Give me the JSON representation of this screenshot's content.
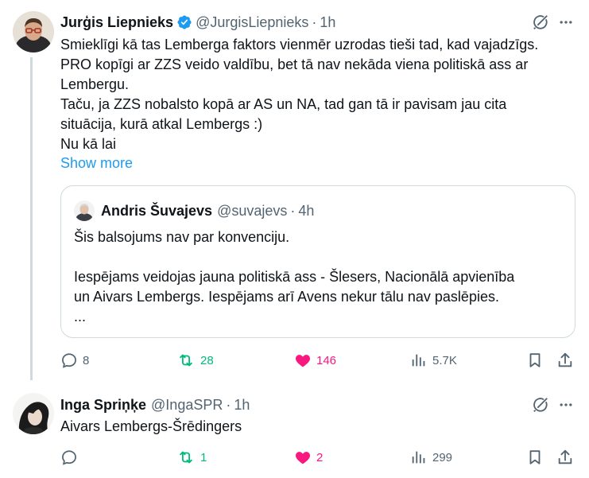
{
  "tweets": [
    {
      "name": "Jurģis Liepnieks",
      "handle": "@JurgisLiepnieks",
      "separator": "·",
      "time": "1h",
      "verified": true,
      "lines": [
        "Smieklīgi kā tas Lemberga faktors vienmēr uzrodas tieši tad, kad vajadzīgs.",
        "PRO kopīgi ar ZZS veido valdību, bet tā nav nekāda viena politiskā ass ar",
        "Lembergu.",
        "Taču, ja ZZS nobalsto kopā ar AS un NA, tad gan tā ir pavisam jau cita",
        "situācija, kurā atkal Lembergs :)",
        "Nu kā lai"
      ],
      "show_more": "Show more",
      "quote": {
        "name": "Andris Šuvajevs",
        "handle": "@suvajevs",
        "separator": "·",
        "time": "4h",
        "lines": [
          "Šis balsojums nav par konvenciju.",
          "",
          "Iespējams veidojas jauna politiskā ass - Šlesers, Nacionālā apvienība",
          "un Aivars Lembergs. Iespējams arī Avens nekur tālu nav paslēpies.",
          "..."
        ]
      },
      "actions": {
        "replies": "8",
        "retweets": "28",
        "likes": "146",
        "views": "5.7K"
      }
    },
    {
      "name": "Inga Spriņķe",
      "handle": "@IngaSPR",
      "separator": "·",
      "time": "1h",
      "verified": false,
      "text": "Aivars Lembergs-Šrēdingers",
      "actions": {
        "replies": "",
        "retweets": "1",
        "likes": "2",
        "views": "299"
      }
    }
  ],
  "colors": {
    "text": "#0f1419",
    "secondary": "#536471",
    "link": "#1d9bf0",
    "retweet": "#00ba7c",
    "like": "#f91880",
    "border": "#cfd9de"
  },
  "icons": [
    "grok-icon",
    "more-icon",
    "reply-icon",
    "retweet-icon",
    "like-icon",
    "views-icon",
    "bookmark-icon",
    "share-icon",
    "verified-icon"
  ]
}
